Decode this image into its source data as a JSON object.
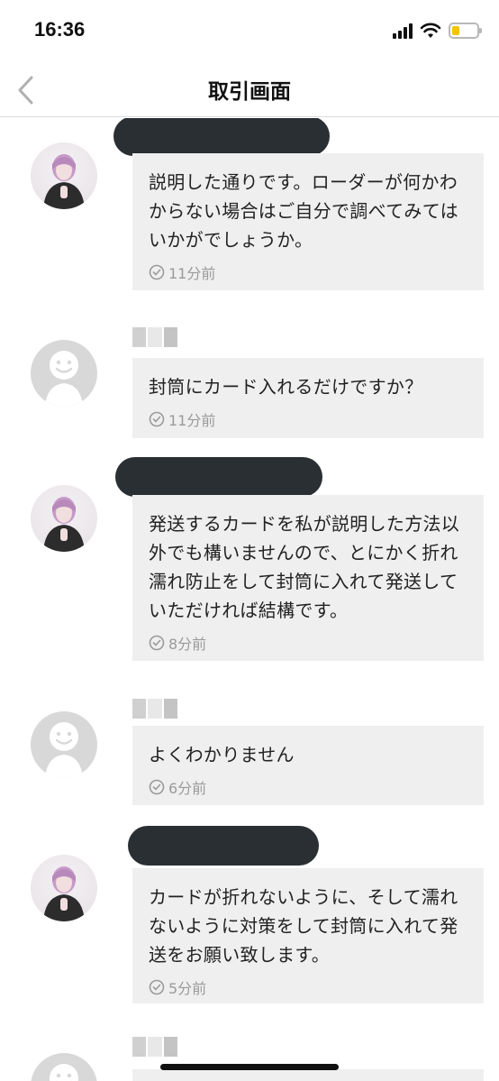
{
  "status_bar": {
    "time": "16:36"
  },
  "nav": {
    "title": "取引画面"
  },
  "messages": [
    {
      "sender": "seller",
      "text": "説明した通りです。ローダーが何かわからない場合はご自分で調べてみてはいかがでしょうか。",
      "time": "11分前"
    },
    {
      "sender": "buyer",
      "text": "封筒にカード入れるだけですか？",
      "time": "11分前"
    },
    {
      "sender": "seller",
      "text": "発送するカードを私が説明した方法以外でも構いませんので、とにかく折れ濡れ防止をして封筒に入れて発送していただければ結構です。",
      "time": "8分前"
    },
    {
      "sender": "buyer",
      "text": "よくわかりません",
      "time": "6分前"
    },
    {
      "sender": "seller",
      "text": "カードが折れないように、そして濡れないように対策をして封筒に入れて発送をお願い致します。",
      "time": "5分前"
    }
  ],
  "colors": {
    "bubble": "#efefef",
    "redaction": "#2a2f33",
    "battery": "#f2c500"
  },
  "icons": {
    "back": "chevron-left-icon",
    "clock": "clock-icon",
    "signal": "cellular-signal-icon",
    "wifi": "wifi-icon",
    "battery": "battery-icon"
  }
}
